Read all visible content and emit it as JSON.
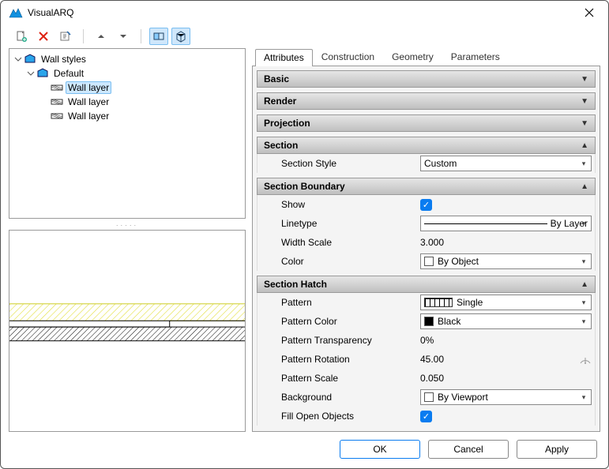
{
  "window": {
    "title": "VisualARQ"
  },
  "toolbar": {
    "new": "new-icon",
    "delete": "delete-icon",
    "rename": "rename-icon",
    "moveUp": "move-up-icon",
    "moveDown": "move-down-icon",
    "view2d": "preview-2d-icon",
    "view3d": "preview-3d-icon"
  },
  "tree": {
    "root": {
      "label": "Wall styles"
    },
    "style": {
      "label": "Default"
    },
    "layers": [
      {
        "label": "Wall layer",
        "selected": true
      },
      {
        "label": "Wall layer",
        "selected": false
      },
      {
        "label": "Wall layer",
        "selected": false
      }
    ]
  },
  "tabs": {
    "attributes": "Attributes",
    "construction": "Construction",
    "geometry": "Geometry",
    "parameters": "Parameters",
    "active": "attributes"
  },
  "groups": {
    "basic": {
      "title": "Basic",
      "expanded": false
    },
    "render": {
      "title": "Render",
      "expanded": false
    },
    "projection": {
      "title": "Projection",
      "expanded": false
    },
    "section": {
      "title": "Section",
      "expanded": true,
      "sectionStyle": {
        "label": "Section Style",
        "value": "Custom"
      }
    },
    "sectionBoundary": {
      "title": "Section Boundary",
      "expanded": true,
      "show": {
        "label": "Show",
        "value": true
      },
      "linetype": {
        "label": "Linetype",
        "value": "By Layer"
      },
      "widthScale": {
        "label": "Width Scale",
        "value": "3.000"
      },
      "color": {
        "label": "Color",
        "value": "By Object"
      }
    },
    "sectionHatch": {
      "title": "Section Hatch",
      "expanded": true,
      "pattern": {
        "label": "Pattern",
        "value": "Single"
      },
      "patternColor": {
        "label": "Pattern Color",
        "value": "Black"
      },
      "patternTransparency": {
        "label": "Pattern Transparency",
        "value": "0%"
      },
      "patternRotation": {
        "label": "Pattern Rotation",
        "value": "45.00"
      },
      "patternScale": {
        "label": "Pattern Scale",
        "value": "0.050"
      },
      "background": {
        "label": "Background",
        "value": "By Viewport"
      },
      "fillOpenObjects": {
        "label": "Fill Open Objects",
        "value": true
      }
    }
  },
  "footer": {
    "ok": "OK",
    "cancel": "Cancel",
    "apply": "Apply"
  }
}
